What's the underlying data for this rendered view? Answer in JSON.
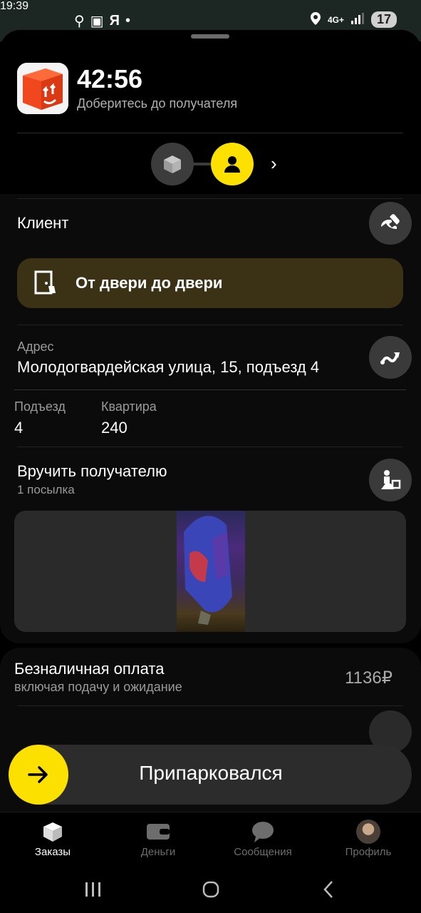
{
  "status_bar": {
    "time": "19:39",
    "left_icons": "Я",
    "network": "4G+",
    "battery": "17"
  },
  "order": {
    "timer": "42:56",
    "subtitle": "Доберитесь до получателя"
  },
  "client": {
    "label": "Клиент"
  },
  "delivery_type": {
    "label": "От двери до двери"
  },
  "address": {
    "label": "Адрес",
    "value": "Молодогвардейская улица, 15, подъезд 4"
  },
  "details": {
    "entrance_label": "Подъезд",
    "entrance_value": "4",
    "apartment_label": "Квартира",
    "apartment_value": "240"
  },
  "handover": {
    "title": "Вручить получателю",
    "count": "1 посылка"
  },
  "payment": {
    "title": "Безналичная оплата",
    "subtitle": "включая подачу и ожидание",
    "amount": "1136₽"
  },
  "action": {
    "label": "Припарковался"
  },
  "tabs": [
    {
      "label": "Заказы"
    },
    {
      "label": "Деньги"
    },
    {
      "label": "Сообщения"
    },
    {
      "label": "Профиль"
    }
  ],
  "colors": {
    "accent": "#fce000",
    "background": "#000000",
    "card": "#3b3115"
  }
}
